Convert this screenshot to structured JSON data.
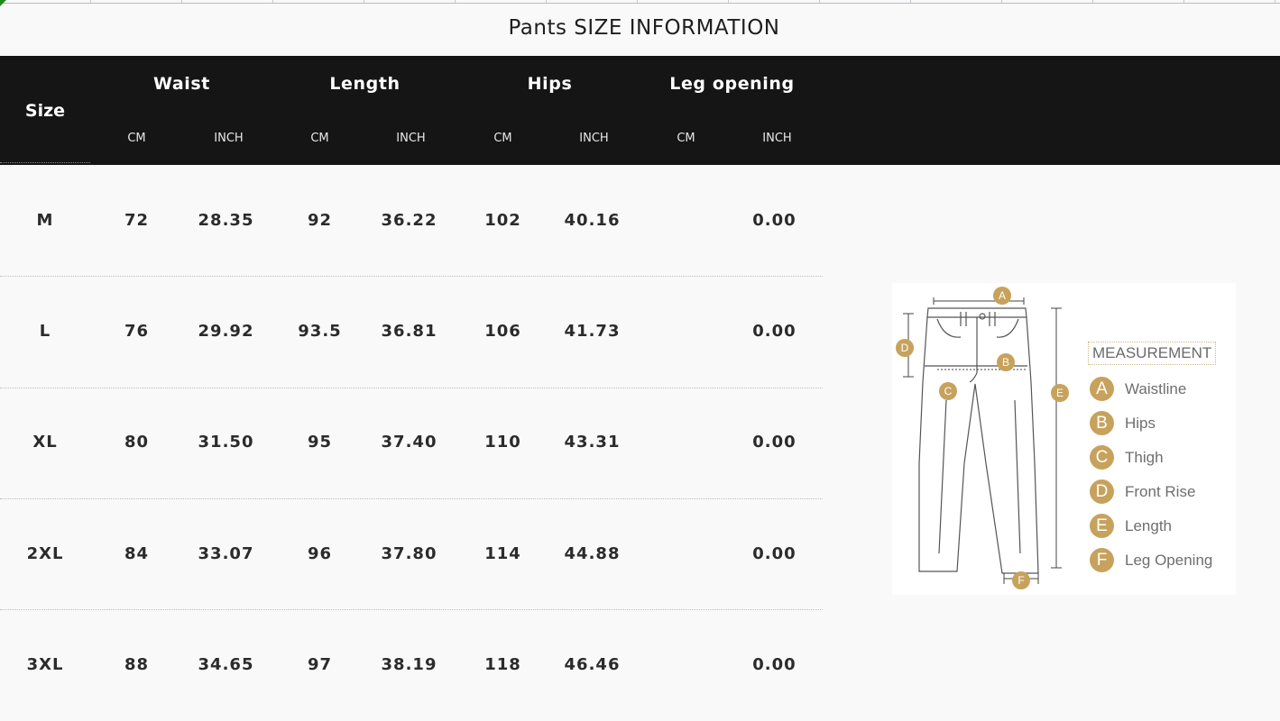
{
  "title": "Pants SIZE INFORMATION",
  "colors": {
    "header_bg": "#151515",
    "badge": "#c7a25c"
  },
  "header": {
    "size_label": "Size",
    "groups": [
      "Waist",
      "Length",
      "Hips",
      "Leg opening"
    ],
    "units": [
      "CM",
      "INCH",
      "CM",
      "INCH",
      "CM",
      "INCH",
      "CM",
      "INCH"
    ]
  },
  "rows": [
    {
      "size": "M",
      "cells": [
        "72",
        "28.35",
        "92",
        "36.22",
        "102",
        "40.16",
        "",
        "0.00"
      ]
    },
    {
      "size": "L",
      "cells": [
        "76",
        "29.92",
        "93.5",
        "36.81",
        "106",
        "41.73",
        "",
        "0.00"
      ]
    },
    {
      "size": "XL",
      "cells": [
        "80",
        "31.50",
        "95",
        "37.40",
        "110",
        "43.31",
        "",
        "0.00"
      ]
    },
    {
      "size": "2XL",
      "cells": [
        "84",
        "33.07",
        "96",
        "37.80",
        "114",
        "44.88",
        "",
        "0.00"
      ]
    },
    {
      "size": "3XL",
      "cells": [
        "88",
        "34.65",
        "97",
        "38.19",
        "118",
        "46.46",
        "",
        "0.00"
      ]
    }
  ],
  "diagram": {
    "legend_title": "MEASUREMENT",
    "legend": [
      {
        "letter": "A",
        "label": "Waistline"
      },
      {
        "letter": "B",
        "label": "Hips"
      },
      {
        "letter": "C",
        "label": "Thigh"
      },
      {
        "letter": "D",
        "label": "Front Rise"
      },
      {
        "letter": "E",
        "label": "Length"
      },
      {
        "letter": "F",
        "label": "Leg Opening"
      }
    ],
    "markers": [
      "A",
      "B",
      "C",
      "D",
      "E",
      "F"
    ]
  }
}
